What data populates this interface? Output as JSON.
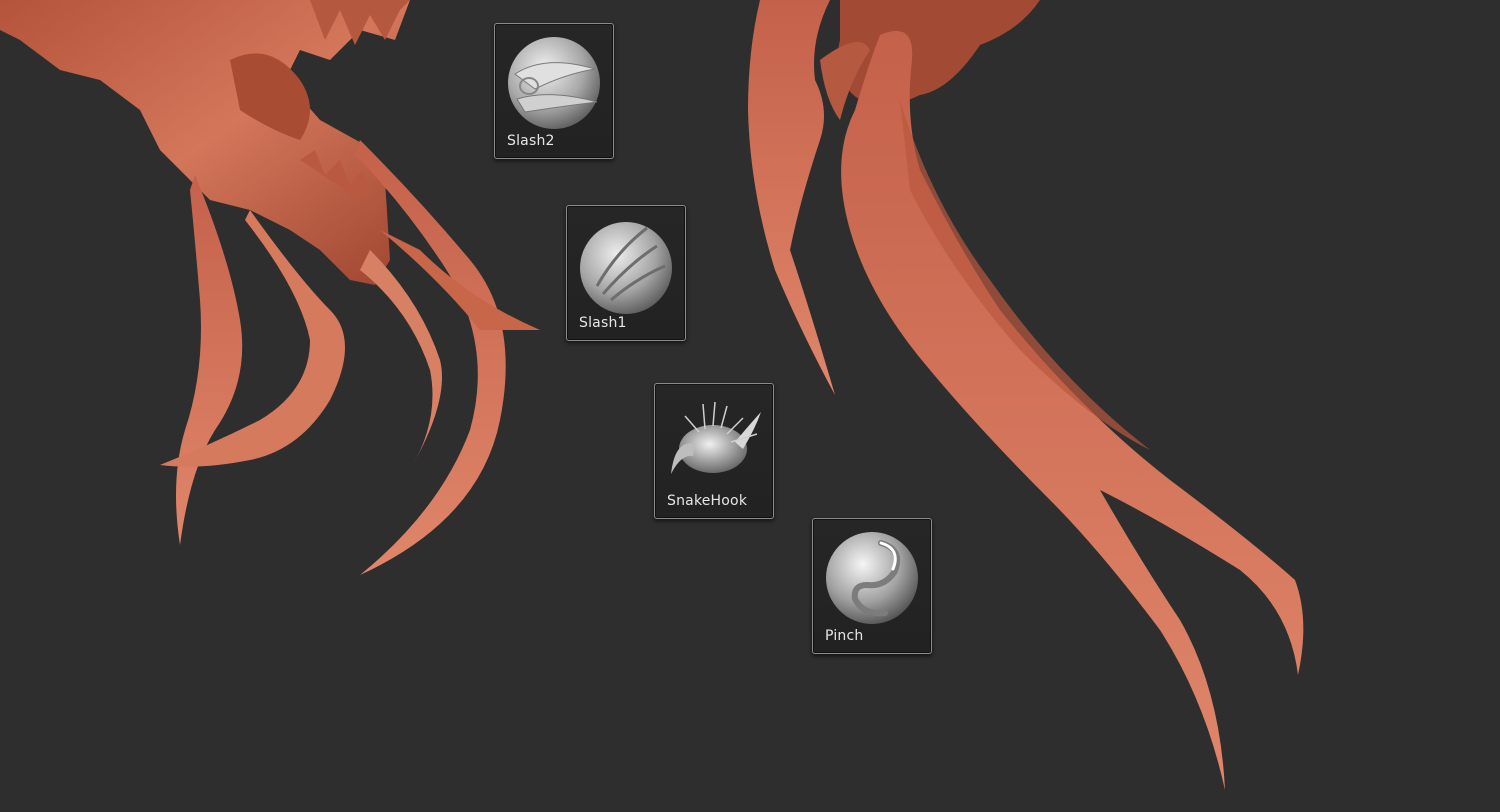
{
  "viewport": {
    "background": "#2e2e2e",
    "model_color": "#c8664a"
  },
  "brushes": [
    {
      "label": "Slash2",
      "icon": "slash2-brush-icon"
    },
    {
      "label": "Slash1",
      "icon": "slash1-brush-icon"
    },
    {
      "label": "SnakeHook",
      "icon": "snakehook-brush-icon"
    },
    {
      "label": "Pinch",
      "icon": "pinch-brush-icon"
    }
  ]
}
